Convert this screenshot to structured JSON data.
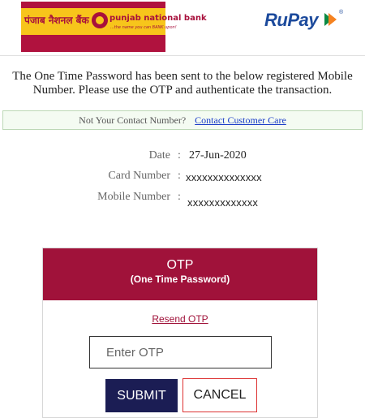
{
  "header": {
    "bank_name_hindi": "पंजाब नैशनल बैंक",
    "bank_name_english": "punjab national bank",
    "bank_tagline": "...the name you can BANK upon!",
    "card_network": "RuPay",
    "card_network_reg": "®",
    "colors": {
      "bank_maroon": "#b0123e",
      "bank_yellow": "#f7c51b",
      "rupay_blue": "#1c4a9c"
    }
  },
  "message": "The One Time Password has been sent to the below registered Mobile Number. Please use the OTP and authenticate the transaction.",
  "contact_bar": {
    "question": "Not Your Contact Number?",
    "link": "Contact Customer Care"
  },
  "details": [
    {
      "label": "Date",
      "value": "27-Jun-2020"
    },
    {
      "label": "Card Number",
      "value": "xxxxxxxxxxxxxx"
    },
    {
      "label": "Mobile Number",
      "value": "xxxxxxxxxxxxx"
    }
  ],
  "otp_panel": {
    "title": "OTP",
    "subtitle": "(One Time Password)",
    "resend": "Resend OTP",
    "input_value": "",
    "input_placeholder": "Enter OTP",
    "submit": "SUBMIT",
    "cancel": "CANCEL",
    "colors": {
      "header": "#a0123a",
      "submit_bg": "#1b1d54",
      "cancel_border": "#dd3333"
    }
  }
}
